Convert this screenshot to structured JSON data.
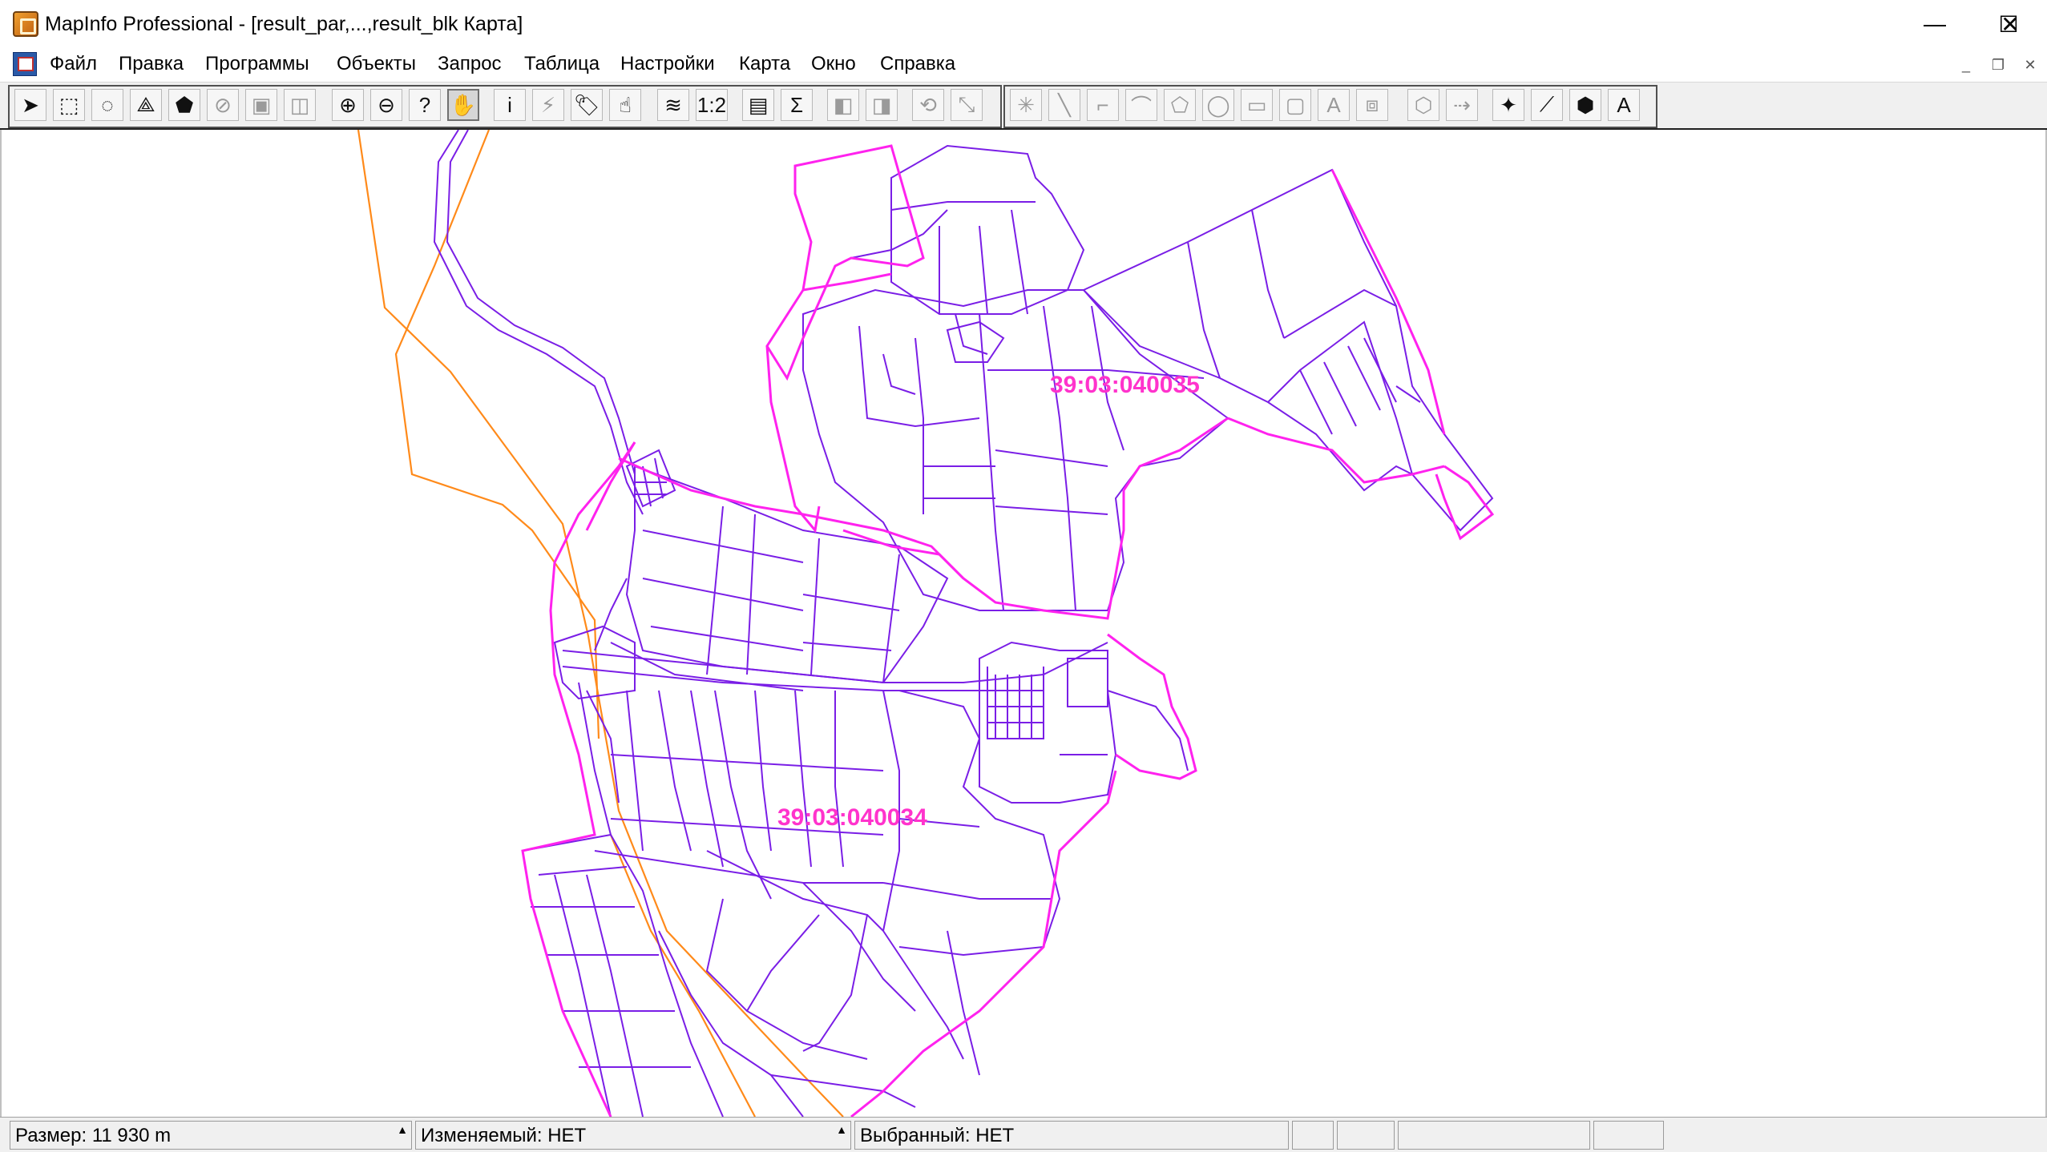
{
  "window": {
    "title": "MapInfo Professional - [result_par,...,result_blk Карта]",
    "minimize": "—",
    "maximize": "☐",
    "close": "✕"
  },
  "menu": {
    "items": [
      "Файл",
      "Правка",
      "Программы",
      "Объекты",
      "Запрос",
      "Таблица",
      "Настройки",
      "Карта",
      "Окно",
      "Справка"
    ],
    "mdi_minimize": "_",
    "mdi_restore": "❐",
    "mdi_close": "✕"
  },
  "toolbar": {
    "tools": [
      {
        "icon": "select-arrow-icon",
        "glyph": "➤"
      },
      {
        "icon": "marquee-select-icon",
        "glyph": "⬚"
      },
      {
        "icon": "radius-select-icon",
        "glyph": "◌"
      },
      {
        "icon": "polygon-select-icon",
        "glyph": "⟁"
      },
      {
        "icon": "boundary-select-icon",
        "glyph": "⬟"
      },
      {
        "icon": "unselect-icon",
        "glyph": "⊘"
      },
      {
        "icon": "invert-selection-icon",
        "glyph": "▣"
      },
      {
        "icon": "graph-select-icon",
        "glyph": "◫"
      },
      {
        "icon": "zoom-in-icon",
        "glyph": "⊕"
      },
      {
        "icon": "zoom-out-icon",
        "glyph": "⊖"
      },
      {
        "icon": "change-view-icon",
        "glyph": "?"
      },
      {
        "icon": "grabber-hand-icon",
        "glyph": "✋"
      },
      {
        "icon": "info-icon",
        "glyph": "i"
      },
      {
        "icon": "hotlink-icon",
        "glyph": "⚡"
      },
      {
        "icon": "label-tool-icon",
        "glyph": "🏷"
      },
      {
        "icon": "drag-map-icon",
        "glyph": "☝"
      },
      {
        "icon": "layer-control-icon",
        "glyph": "≋"
      },
      {
        "icon": "ruler-icon",
        "glyph": "1:2"
      },
      {
        "icon": "legend-icon",
        "glyph": "▤"
      },
      {
        "icon": "statistics-icon",
        "glyph": "Σ"
      },
      {
        "icon": "clip-region-icon",
        "glyph": "◧"
      },
      {
        "icon": "set-clip-icon",
        "glyph": "◨"
      },
      {
        "icon": "reshape-icon",
        "glyph": "⟲"
      },
      {
        "icon": "add-node-icon",
        "glyph": "⤡"
      },
      {
        "icon": "symbol-tool-icon",
        "glyph": "✳"
      },
      {
        "icon": "line-tool-icon",
        "glyph": "╲"
      },
      {
        "icon": "polyline-tool-icon",
        "glyph": "⌐"
      },
      {
        "icon": "arc-tool-icon",
        "glyph": "⌒"
      },
      {
        "icon": "polygon-tool-icon",
        "glyph": "⬠"
      },
      {
        "icon": "ellipse-tool-icon",
        "glyph": "◯"
      },
      {
        "icon": "rectangle-tool-icon",
        "glyph": "▭"
      },
      {
        "icon": "rounded-rectangle-tool-icon",
        "glyph": "▢"
      },
      {
        "icon": "text-tool-icon",
        "glyph": "A"
      },
      {
        "icon": "frame-tool-icon",
        "glyph": "⧈"
      },
      {
        "icon": "reshape-polygon-icon",
        "glyph": "⬡"
      },
      {
        "icon": "add-node-arrow-icon",
        "glyph": "⇢"
      },
      {
        "icon": "symbol-style-icon",
        "glyph": "✦"
      },
      {
        "icon": "line-style-icon",
        "glyph": "⟋"
      },
      {
        "icon": "region-style-icon",
        "glyph": "⬢"
      },
      {
        "icon": "text-style-icon",
        "glyph": "A"
      }
    ]
  },
  "map": {
    "labels": [
      "39:03:040035",
      "39:03:040034"
    ],
    "colors": {
      "boundary": "#ff22ee",
      "parcel": "#7a1ee6",
      "road": "#ff8a1a",
      "label": "#ff33cc"
    }
  },
  "status": {
    "size": "Размер: 11 930 m",
    "editable": "Изменяемый: НЕТ",
    "selected": "Выбранный: НЕТ"
  }
}
